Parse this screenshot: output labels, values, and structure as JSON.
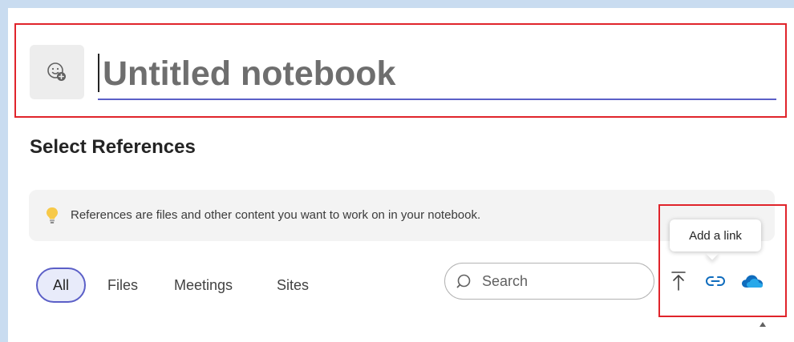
{
  "notebook": {
    "title_placeholder": "Untitled notebook",
    "title_value": ""
  },
  "references": {
    "heading": "Select References",
    "info_text": "References are files and other content you want to work on in your notebook.",
    "tabs": [
      {
        "label": "All",
        "selected": true
      },
      {
        "label": "Files",
        "selected": false
      },
      {
        "label": "Meetings",
        "selected": false
      },
      {
        "label": "Sites",
        "selected": false
      }
    ],
    "search": {
      "placeholder": "Search",
      "value": ""
    },
    "actions": {
      "upload_icon": "upload-icon",
      "link_icon": "link-icon",
      "onedrive_icon": "onedrive-icon",
      "tooltip": "Add a link"
    }
  },
  "colors": {
    "accent": "#5b5fc7",
    "highlight_box": "#e0242b",
    "onedrive_blue": "#0f6cbd",
    "link_blue": "#0f6cbd"
  }
}
